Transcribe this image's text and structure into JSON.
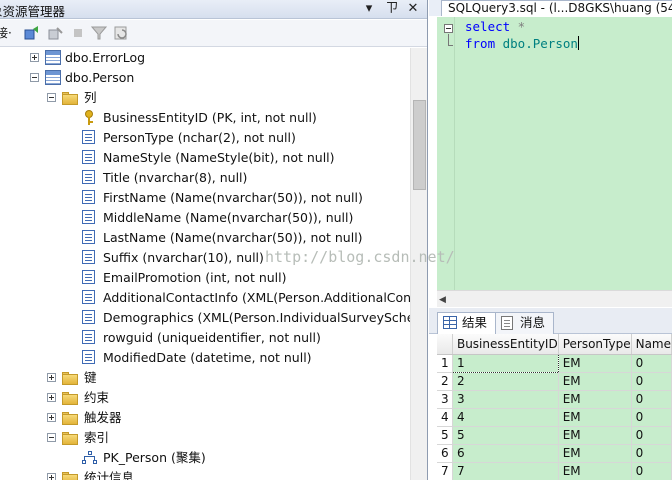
{
  "object_explorer": {
    "title": "象资源管理器",
    "controls": {
      "dropdown": "▾",
      "pin": "ㄗ",
      "close": "✕"
    },
    "toolbar_label": "接·"
  },
  "tree": [
    {
      "label": "dbo.ErrorLog",
      "level": 2,
      "expander": "plus",
      "icon": "table-icon"
    },
    {
      "label": "dbo.Person",
      "level": 2,
      "expander": "minus",
      "icon": "table-icon"
    },
    {
      "label": "列",
      "level": 3,
      "expander": "minus",
      "icon": "folder-icon"
    },
    {
      "label": "BusinessEntityID (PK, int, not null)",
      "level": 4,
      "icon": "key-icon"
    },
    {
      "label": "PersonType (nchar(2), not null)",
      "level": 4,
      "icon": "column-icon"
    },
    {
      "label": "NameStyle (NameStyle(bit), not null)",
      "level": 4,
      "icon": "column-icon"
    },
    {
      "label": "Title (nvarchar(8), null)",
      "level": 4,
      "icon": "column-icon"
    },
    {
      "label": "FirstName (Name(nvarchar(50)), not null)",
      "level": 4,
      "icon": "column-icon"
    },
    {
      "label": "MiddleName (Name(nvarchar(50)), null)",
      "level": 4,
      "icon": "column-icon"
    },
    {
      "label": "LastName (Name(nvarchar(50)), not null)",
      "level": 4,
      "icon": "column-icon"
    },
    {
      "label": "Suffix (nvarchar(10), null)",
      "level": 4,
      "icon": "column-icon"
    },
    {
      "label": "EmailPromotion (int, not null)",
      "level": 4,
      "icon": "column-icon"
    },
    {
      "label": "AdditionalContactInfo (XML(Person.AdditionalContac",
      "level": 4,
      "icon": "column-icon"
    },
    {
      "label": "Demographics (XML(Person.IndividualSurveySchema",
      "level": 4,
      "icon": "column-icon"
    },
    {
      "label": "rowguid (uniqueidentifier, not null)",
      "level": 4,
      "icon": "column-icon"
    },
    {
      "label": "ModifiedDate (datetime, not null)",
      "level": 4,
      "icon": "column-icon"
    },
    {
      "label": "键",
      "level": 3,
      "expander": "plus",
      "icon": "folder-icon"
    },
    {
      "label": "约束",
      "level": 3,
      "expander": "plus",
      "icon": "folder-icon"
    },
    {
      "label": "触发器",
      "level": 3,
      "expander": "plus",
      "icon": "folder-icon"
    },
    {
      "label": "索引",
      "level": 3,
      "expander": "minus",
      "icon": "folder-icon"
    },
    {
      "label": "PK_Person (聚集)",
      "level": 4,
      "icon": "index-icon"
    },
    {
      "label": "统计信息",
      "level": 3,
      "expander": "plus",
      "icon": "folder-icon"
    }
  ],
  "editor": {
    "tab_title": "SQLQuery3.sql - (l...D8GKS\\huang (54",
    "line1_kw": "select",
    "line1_rest": " *",
    "line2_kw": "from",
    "line2_rest": " dbo.Person",
    "watermark": "http://blog.csdn.net/",
    "bg_color": "#c7edcc"
  },
  "results": {
    "tab_results": "结果",
    "tab_messages": "消息",
    "columns": [
      "",
      "BusinessEntityID",
      "PersonType",
      "Name"
    ],
    "rows": [
      [
        "1",
        "1",
        "EM",
        "0"
      ],
      [
        "2",
        "2",
        "EM",
        "0"
      ],
      [
        "3",
        "3",
        "EM",
        "0"
      ],
      [
        "4",
        "4",
        "EM",
        "0"
      ],
      [
        "5",
        "5",
        "EM",
        "0"
      ],
      [
        "6",
        "6",
        "EM",
        "0"
      ],
      [
        "7",
        "7",
        "EM",
        "0"
      ]
    ]
  }
}
